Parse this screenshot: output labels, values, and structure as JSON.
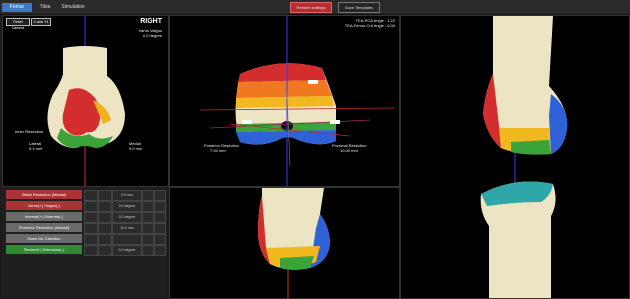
{
  "tabs": [
    {
      "label": "Femur"
    },
    {
      "label": "Tibia"
    },
    {
      "label": "Simulation"
    }
  ],
  "toolbar": {
    "active_button": "Restore settings",
    "save_button": "Save Templates"
  },
  "left_view": {
    "reset_camera": "Reset Camera",
    "axis_tool": "Z-axis Y4",
    "side": "RIGHT",
    "varus_label": "Varus Valgus",
    "varus_value": "0.0 degree",
    "inner_resection": "Inner Resection",
    "lateral_label": "Lateral",
    "lateral_value": "9.1 mm",
    "medial_label": "Medial",
    "medial_value": "9.0 mm"
  },
  "center_view": {
    "angle1": "TEA-PCA Angle : 1.22",
    "angle2": "TEA-Femur Cut Angle : 0.00",
    "posterior_resection_label": "Posterior Resection",
    "posterior_resection_value": "7.04 mm",
    "proximal_resection_label": "Proximal Resection",
    "proximal_resection_value": "10.00 mm"
  },
  "controls": [
    {
      "label": "Distal Resection (Medial)",
      "value": "9.0 mm",
      "color": "#a93434"
    },
    {
      "label": "Varus(+) Valgus(-)",
      "value": "0.0 degree",
      "color": "#a93434"
    },
    {
      "label": "Internal(+) External(-)",
      "value": "0.0 degree",
      "color": "#6a6a6a"
    },
    {
      "label": "Posterior Resection (Medial)",
      "value": "10.0 mm",
      "color": "#6a6a6a"
    },
    {
      "label": "Move ML Direction",
      "value": "",
      "color": "#6a6a6a"
    },
    {
      "label": "Flexion(+) Extension(-)",
      "value": "0.0 degree",
      "color": "#2f8a36"
    }
  ]
}
